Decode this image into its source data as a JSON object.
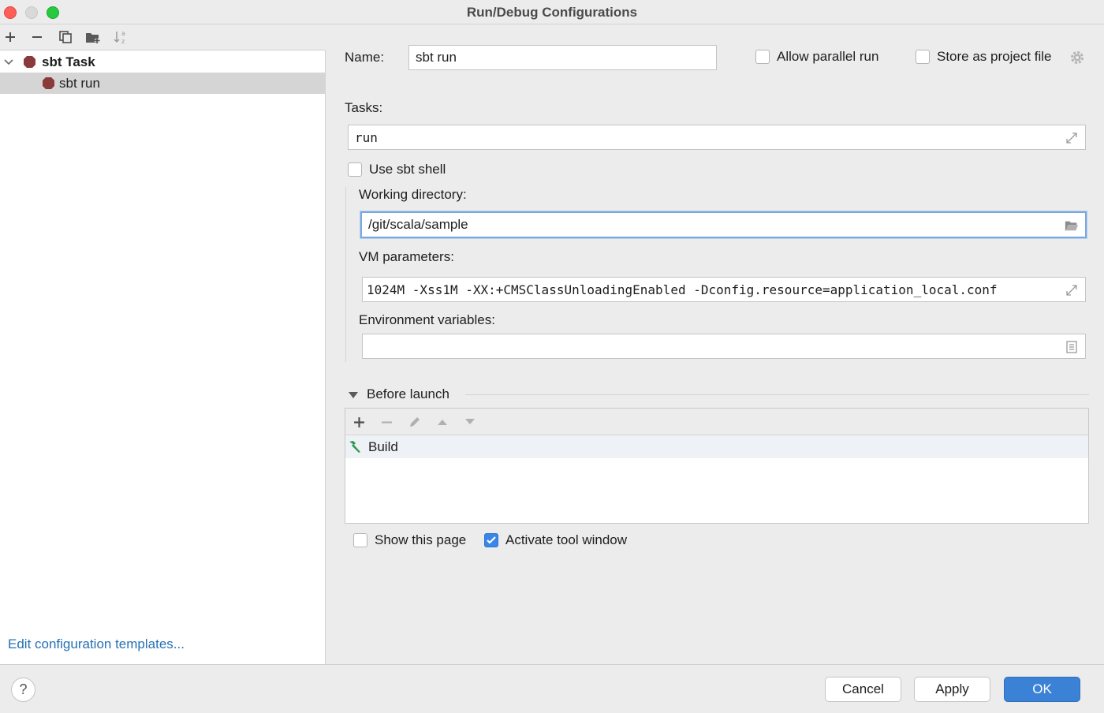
{
  "window": {
    "title": "Run/Debug Configurations"
  },
  "left_toolbar": {
    "icons": [
      "plus-icon",
      "minus-icon",
      "copy-icon",
      "folder-add-icon",
      "sort-icon"
    ]
  },
  "tree": {
    "group_label": "sbt Task",
    "item_label": "sbt run"
  },
  "edit_templates_link": "Edit configuration templates...",
  "form": {
    "name_label": "Name:",
    "name_value": "sbt run",
    "allow_parallel_label": "Allow parallel run",
    "store_project_label": "Store as project file",
    "tasks_label": "Tasks:",
    "tasks_value": "run",
    "use_sbt_shell_label": "Use sbt shell",
    "working_dir_label": "Working directory:",
    "working_dir_value": "/git/scala/sample",
    "vm_params_label": "VM parameters:",
    "vm_params_value": "1024M -Xss1M -XX:+CMSClassUnloadingEnabled -Dconfig.resource=application_local.conf",
    "env_vars_label": "Environment variables:",
    "env_vars_value": ""
  },
  "before_launch": {
    "title": "Before launch",
    "items": [
      {
        "label": "Build",
        "icon": "hammer-icon"
      }
    ]
  },
  "options": {
    "show_page_label": "Show this page",
    "activate_tool_label": "Activate tool window"
  },
  "buttons": {
    "cancel": "Cancel",
    "apply": "Apply",
    "ok": "OK",
    "help": "?"
  },
  "colors": {
    "accent": "#3b82d6",
    "link": "#2470b3",
    "sbt_icon": "#8b3a3a",
    "build_icon": "#2e9a4f"
  }
}
